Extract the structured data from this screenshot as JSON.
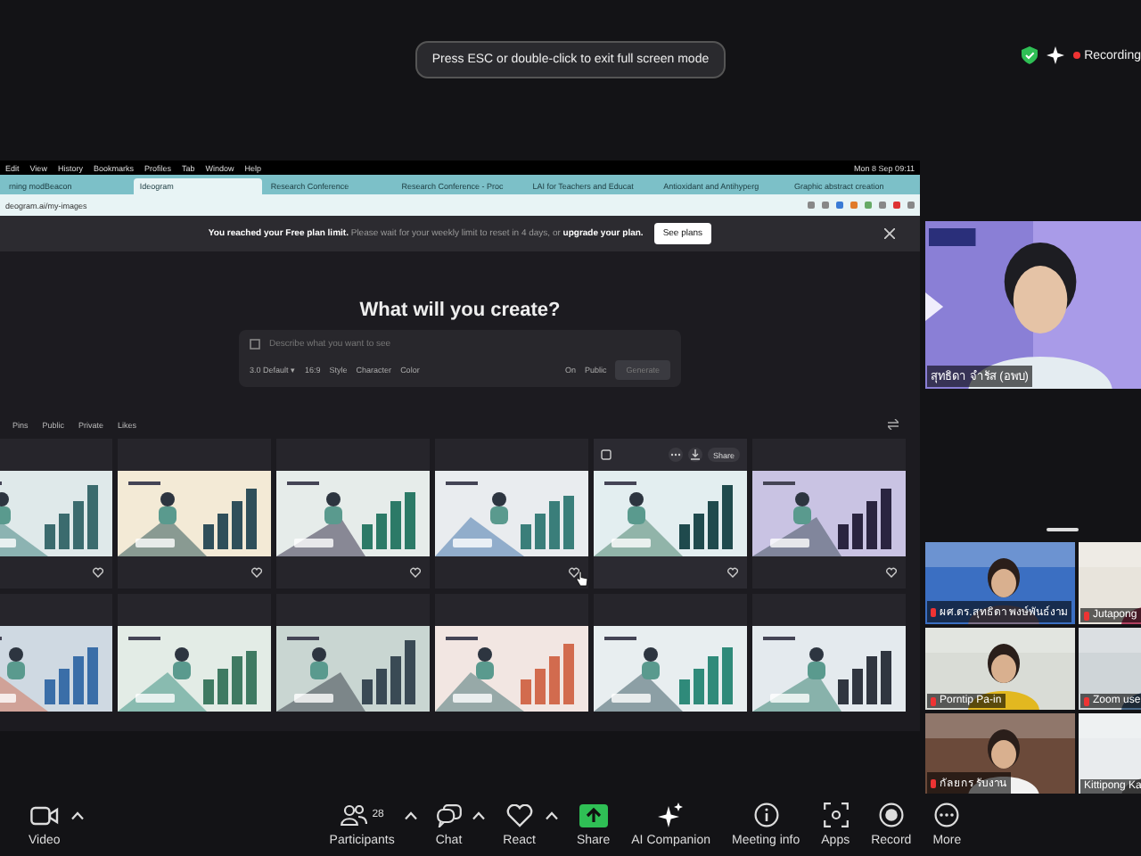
{
  "notice": "Press ESC or double-click to exit full screen mode",
  "recording": {
    "label": "Recording"
  },
  "shared_screen": {
    "menu_bar": {
      "items": [
        "Edit",
        "View",
        "History",
        "Bookmarks",
        "Profiles",
        "Tab",
        "Window",
        "Help"
      ],
      "clock": "Mon 8 Sep 09:11"
    },
    "tabs": [
      {
        "title": "rning modBeacon",
        "selected": false
      },
      {
        "title": "Ideogram",
        "selected": true
      },
      {
        "title": "Research Conference",
        "selected": false
      },
      {
        "title": "Research Conference - Proc",
        "selected": false
      },
      {
        "title": "LAI for Teachers and Educat",
        "selected": false
      },
      {
        "title": "Antioxidant and Antihyperg",
        "selected": false
      },
      {
        "title": "Graphic abstract creation",
        "selected": false
      }
    ],
    "address": "deogram.ai/my-images",
    "banner": {
      "text": "**You reached your Free plan limit.** Please wait for your weekly limit to reset in 4 days, or **upgrade your plan.**",
      "button": "See plans"
    },
    "heading": "What will you create?",
    "prompt": {
      "placeholder": "Describe what you want to see",
      "options": [
        "3.0 Default ▾",
        "16:9",
        "Style",
        "Character",
        "Color"
      ],
      "magic_prompt": "On",
      "visibility": "Public",
      "generate": {
        "label": "Generate",
        "disabled": true
      }
    },
    "filters": [
      "Pins",
      "Public",
      "Private",
      "Likes"
    ],
    "image_rows": [
      {
        "cards": [
          {
            "kind": "picture",
            "hovered": false
          },
          {
            "kind": "picture",
            "hovered": false
          },
          {
            "kind": "picture",
            "hovered": false
          },
          {
            "kind": "picture",
            "hovered": false
          },
          {
            "kind": "picture",
            "hovered": true,
            "share_label": "Share"
          },
          {
            "kind": "picture",
            "hovered": false
          }
        ]
      },
      {
        "cards": [
          {
            "kind": "picture",
            "hovered": false
          },
          {
            "kind": "picture",
            "hovered": false
          },
          {
            "kind": "picture",
            "hovered": false
          },
          {
            "kind": "picture",
            "hovered": false
          },
          {
            "kind": "picture",
            "hovered": false
          },
          {
            "kind": "picture",
            "hovered": false
          }
        ]
      }
    ]
  },
  "speaker": {
    "name": "สุทธิดา จำรัส (อพบ)"
  },
  "gallery": [
    {
      "name": "ผศ.ดร.สุทธิดา พงษ์พันธ์งาม",
      "muted": true
    },
    {
      "name": "Jutapong",
      "muted": true
    },
    {
      "name": "Porntip Pa-in",
      "muted": true
    },
    {
      "name": "Zoom use",
      "muted": true
    },
    {
      "name": "กัลยกร รับงาน",
      "muted": true
    },
    {
      "name": "Kittipong Ka",
      "muted": false
    }
  ],
  "toolbar": [
    {
      "kind": "video",
      "label": "Video",
      "caret": true
    },
    {
      "kind": "participants",
      "label": "Participants",
      "count": "28",
      "caret": true
    },
    {
      "kind": "chat",
      "label": "Chat",
      "caret": true
    },
    {
      "kind": "react",
      "label": "React",
      "caret": true
    },
    {
      "kind": "share",
      "label": "Share",
      "caret": false
    },
    {
      "kind": "ai",
      "label": "AI Companion",
      "caret": false
    },
    {
      "kind": "info",
      "label": "Meeting info",
      "caret": false
    },
    {
      "kind": "apps",
      "label": "Apps",
      "caret": false
    },
    {
      "kind": "record",
      "label": "Record",
      "caret": false
    },
    {
      "kind": "more",
      "label": "More",
      "caret": false
    }
  ]
}
